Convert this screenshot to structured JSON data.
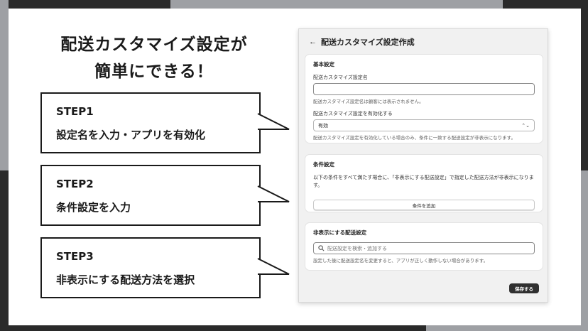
{
  "headline": {
    "line1": "配送カスタマイズ設定が",
    "line2": "簡単にできる！"
  },
  "steps": [
    {
      "title": "STEP1",
      "desc": "設定名を入力・アプリを有効化"
    },
    {
      "title": "STEP2",
      "desc": "条件設定を入力"
    },
    {
      "title": "STEP3",
      "desc": "非表示にする配送方法を選択"
    }
  ],
  "panel": {
    "title": "配送カスタマイズ設定作成",
    "basic": {
      "title": "基本設定",
      "name_label": "配送カスタマイズ設定名",
      "name_value": "",
      "name_help": "配送カスタマイズ設定名は顧客には表示されません。",
      "enable_label": "配送カスタマイズ設定を有効化する",
      "enable_value": "有効",
      "enable_help": "配送カスタマイズ設定を有効化している場合のみ、条件に一致する配送設定が非表示になります。"
    },
    "conditions": {
      "title": "条件設定",
      "desc": "以下の条件をすべて満たす場合に、「非表示にする配送設定」で指定した配送方法が非表示になります。",
      "add_button": "条件を追加"
    },
    "hidden": {
      "title": "非表示にする配送設定",
      "search_placeholder": "配送設定を検索・追加する",
      "help": "設定した後に配送設定名を変更すると、アプリが正しく動作しない場合があります。"
    },
    "save_button": "保存する"
  },
  "colors": {
    "dark": "#2a2a2a",
    "gray": "#9ea0a4",
    "save": "#303030"
  }
}
